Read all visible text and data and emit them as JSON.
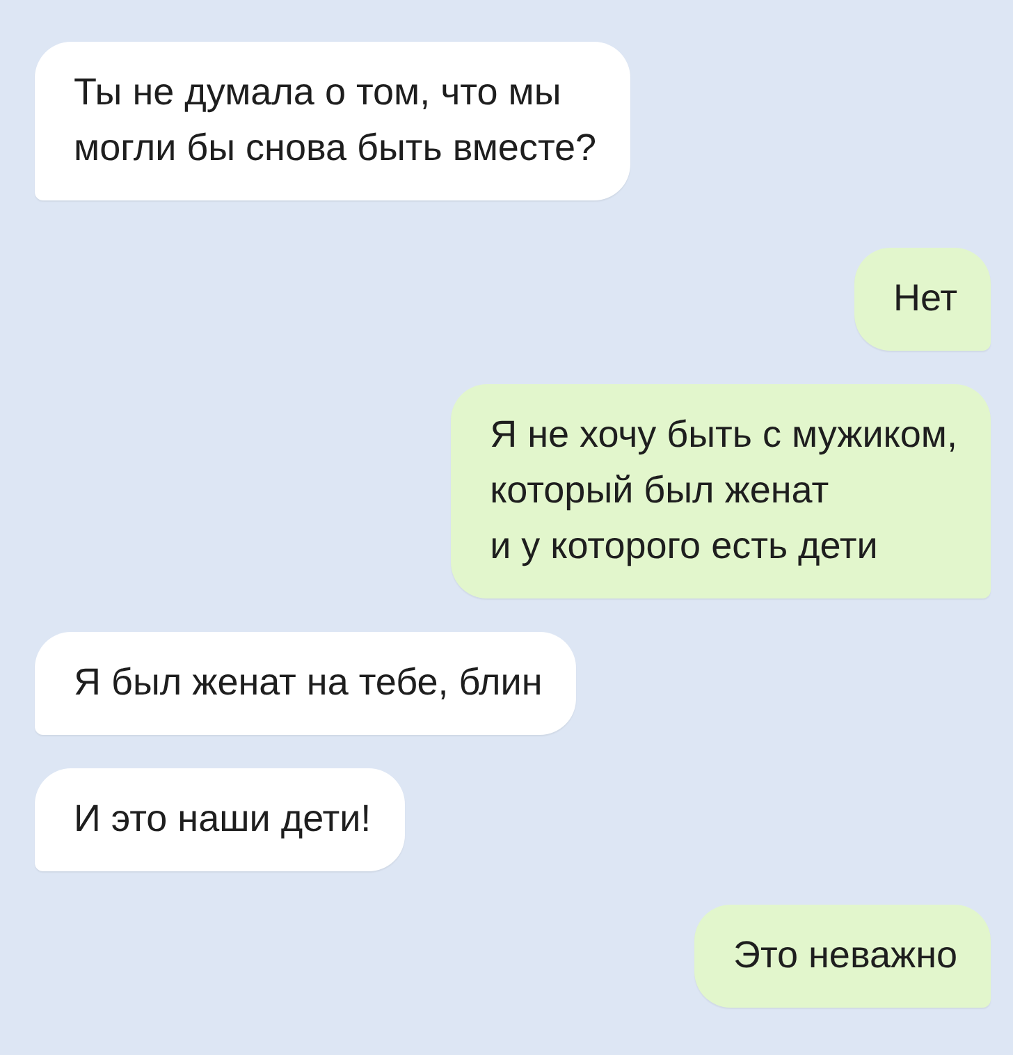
{
  "messages": [
    {
      "kind": "incoming",
      "lines": [
        "Ты не думала о том, что мы",
        "могли бы снова быть вместе?"
      ]
    },
    {
      "kind": "outgoing",
      "lines": [
        "Нет"
      ]
    },
    {
      "kind": "outgoing",
      "lines": [
        "Я не хочу быть с мужиком,",
        "который был женат",
        "и у которого есть дети"
      ]
    },
    {
      "kind": "incoming",
      "lines": [
        "Я был женат на тебе, блин"
      ]
    },
    {
      "kind": "incoming",
      "lines": [
        "И это наши дети!"
      ]
    },
    {
      "kind": "outgoing",
      "lines": [
        "Это неважно"
      ]
    }
  ]
}
